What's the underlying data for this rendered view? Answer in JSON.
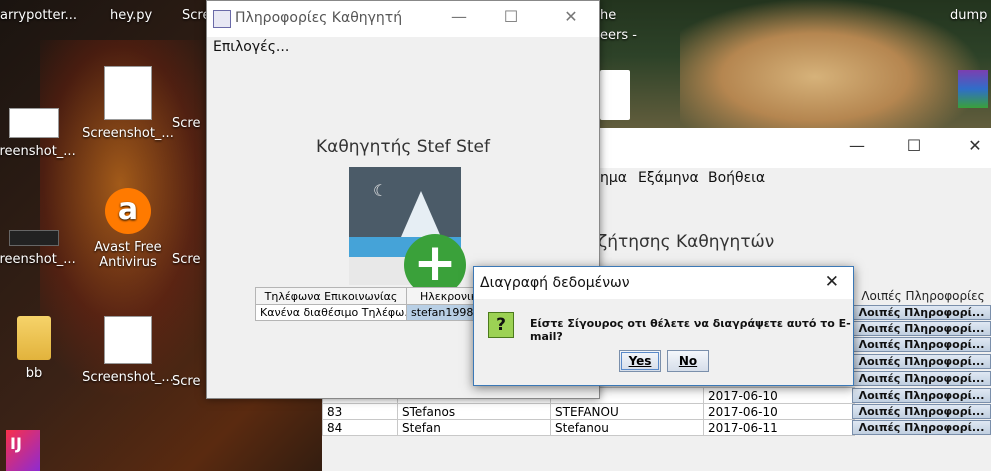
{
  "desktop": {
    "top_labels": [
      "arrypotter...",
      "hey.py",
      "Scre",
      "he",
      "eers -",
      "dump"
    ],
    "icons": [
      {
        "label": "creenshot_..."
      },
      {
        "label": "Screenshot_..."
      },
      {
        "label": "creenshot_..."
      },
      {
        "label": "Avast Free Antivirus"
      },
      {
        "label": "bb"
      },
      {
        "label": "Screenshot_..."
      },
      {
        "label": "Scre"
      },
      {
        "label": "Scre"
      },
      {
        "label": "Scre"
      }
    ],
    "ij_label": "IJ"
  },
  "background_app": {
    "menu": [
      "ημα",
      "Εξάμηνα",
      "Βοήθεια"
    ],
    "heading": "ζήτησης Καθηγητών",
    "column_header": "Λοιπές Πληροφορίες",
    "info_button_label": "Λοιπές Πληροφορί...",
    "rows": [
      {
        "id": "",
        "first": "",
        "last": "",
        "date": "2017-06-10"
      },
      {
        "id": "83",
        "first": "STefanos",
        "last": "STEFANOU",
        "date": "2017-06-10"
      },
      {
        "id": "84",
        "first": "Stefan",
        "last": "Stefanou",
        "date": "2017-06-11"
      }
    ]
  },
  "prof_window": {
    "title": "Πληροφορίες Καθηγητή",
    "menu": "Επιλογές...",
    "heading": "Καθηγητής Stef Stef",
    "table": {
      "headers": [
        "Τηλέφωνα Επικοινωνίας",
        "Ηλεκρονικό"
      ],
      "row": [
        "Κανένα διαθέσιμο Τηλέφω...",
        "stefan1998x"
      ]
    }
  },
  "dialog": {
    "title": "Διαγραφή δεδομένων",
    "message": "Είστε Σίγουρος οτι θέλετε να διαγράψετε αυτό το E-mail?",
    "yes": "Yes",
    "no": "No"
  }
}
